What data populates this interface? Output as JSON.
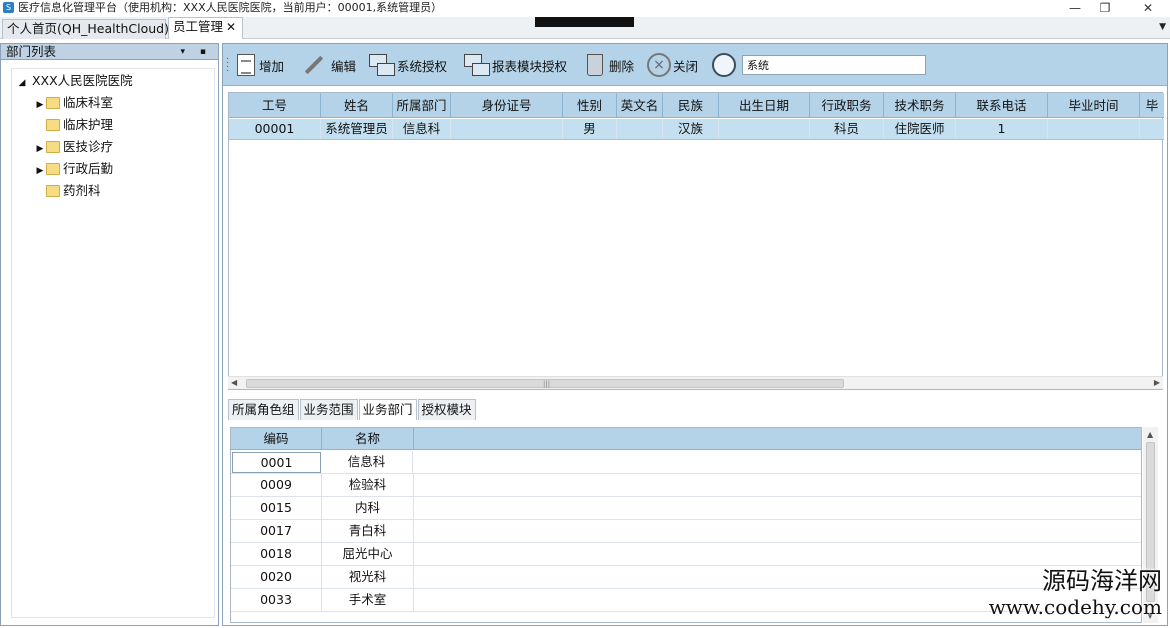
{
  "window": {
    "title": "医疗信息化管理平台（使用机构：XXX人民医院医院，当前用户：00001,系统管理员）",
    "minimize": "—",
    "restore": "❐",
    "close": "✕"
  },
  "tabs": [
    {
      "label": "个人首页(QH_HealthCloud)",
      "active": false
    },
    {
      "label": "员工管理",
      "active": true,
      "close": "✕"
    }
  ],
  "left_panel": {
    "title": "部门列表",
    "icons": "▾ ▪",
    "tree": {
      "root": "XXX人民医院医院",
      "children": [
        {
          "label": "临床科室",
          "expandable": true
        },
        {
          "label": "临床护理",
          "expandable": false
        },
        {
          "label": "医技诊疗",
          "expandable": true
        },
        {
          "label": "行政后勤",
          "expandable": true
        },
        {
          "label": "药剂科",
          "expandable": false
        }
      ]
    }
  },
  "toolbar": {
    "add": "增加",
    "edit": "编辑",
    "sys_auth": "系统授权",
    "report_auth": "报表模块授权",
    "delete": "删除",
    "close": "关闭",
    "search_value": "系统"
  },
  "staff_grid": {
    "columns": [
      "工号",
      "姓名",
      "所属部门",
      "身份证号",
      "性别",
      "英文名",
      "民族",
      "出生日期",
      "行政职务",
      "技术职务",
      "联系电话",
      "毕业时间",
      "毕"
    ],
    "rows": [
      [
        "00001",
        "系统管理员",
        "信息科",
        "",
        "男",
        "",
        "汉族",
        "",
        "科员",
        "住院医师",
        "1",
        "",
        ""
      ]
    ]
  },
  "sub_tabs": [
    "所属角色组",
    "业务范围",
    "业务部门",
    "授权模块"
  ],
  "active_sub_tab": 2,
  "dept_grid": {
    "columns": [
      "编码",
      "名称"
    ],
    "rows": [
      [
        "0001",
        "信息科"
      ],
      [
        "0009",
        "检验科"
      ],
      [
        "0015",
        "内科"
      ],
      [
        "0017",
        "青白科"
      ],
      [
        "0018",
        "屈光中心"
      ],
      [
        "0020",
        "视光科"
      ],
      [
        "0033",
        "手术室"
      ]
    ]
  },
  "watermark": {
    "line1": "源码海洋网",
    "line2": "www.codehy.com"
  }
}
